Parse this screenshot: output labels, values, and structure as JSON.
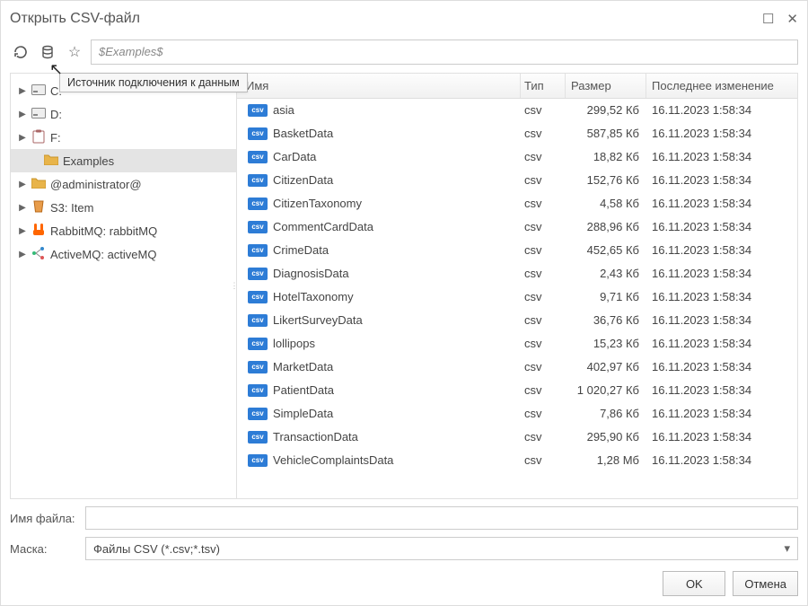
{
  "window": {
    "title": "Открыть CSV-файл"
  },
  "toolbar": {
    "path_placeholder": "$Examples$",
    "tooltip": "Источник подключения к данным"
  },
  "tree": {
    "items": [
      {
        "label": "C:",
        "icon": "drive",
        "expandable": true,
        "selected": false
      },
      {
        "label": "D:",
        "icon": "drive",
        "expandable": true,
        "selected": false
      },
      {
        "label": "F:",
        "icon": "clipboard",
        "expandable": true,
        "selected": false
      },
      {
        "label": "Examples",
        "icon": "folder",
        "expandable": false,
        "selected": true
      },
      {
        "label": "@administrator@",
        "icon": "folder-user",
        "expandable": true,
        "selected": false
      },
      {
        "label": "S3: Item",
        "icon": "bucket",
        "expandable": true,
        "selected": false
      },
      {
        "label": "RabbitMQ: rabbitMQ",
        "icon": "rabbit",
        "expandable": true,
        "selected": false
      },
      {
        "label": "ActiveMQ: activeMQ",
        "icon": "nodes",
        "expandable": true,
        "selected": false
      }
    ]
  },
  "columns": {
    "name": "Имя",
    "type": "Тип",
    "size": "Размер",
    "modified": "Последнее изменение"
  },
  "files": [
    {
      "name": "asia",
      "type": "csv",
      "size": "299,52 Кб",
      "modified": "16.11.2023 1:58:34"
    },
    {
      "name": "BasketData",
      "type": "csv",
      "size": "587,85 Кб",
      "modified": "16.11.2023 1:58:34"
    },
    {
      "name": "CarData",
      "type": "csv",
      "size": "18,82 Кб",
      "modified": "16.11.2023 1:58:34"
    },
    {
      "name": "CitizenData",
      "type": "csv",
      "size": "152,76 Кб",
      "modified": "16.11.2023 1:58:34"
    },
    {
      "name": "CitizenTaxonomy",
      "type": "csv",
      "size": "4,58 Кб",
      "modified": "16.11.2023 1:58:34"
    },
    {
      "name": "CommentCardData",
      "type": "csv",
      "size": "288,96 Кб",
      "modified": "16.11.2023 1:58:34"
    },
    {
      "name": "CrimeData",
      "type": "csv",
      "size": "452,65 Кб",
      "modified": "16.11.2023 1:58:34"
    },
    {
      "name": "DiagnosisData",
      "type": "csv",
      "size": "2,43 Кб",
      "modified": "16.11.2023 1:58:34"
    },
    {
      "name": "HotelTaxonomy",
      "type": "csv",
      "size": "9,71 Кб",
      "modified": "16.11.2023 1:58:34"
    },
    {
      "name": "LikertSurveyData",
      "type": "csv",
      "size": "36,76 Кб",
      "modified": "16.11.2023 1:58:34"
    },
    {
      "name": "lollipops",
      "type": "csv",
      "size": "15,23 Кб",
      "modified": "16.11.2023 1:58:34"
    },
    {
      "name": "MarketData",
      "type": "csv",
      "size": "402,97 Кб",
      "modified": "16.11.2023 1:58:34"
    },
    {
      "name": "PatientData",
      "type": "csv",
      "size": "1 020,27 Кб",
      "modified": "16.11.2023 1:58:34"
    },
    {
      "name": "SimpleData",
      "type": "csv",
      "size": "7,86 Кб",
      "modified": "16.11.2023 1:58:34"
    },
    {
      "name": "TransactionData",
      "type": "csv",
      "size": "295,90 Кб",
      "modified": "16.11.2023 1:58:34"
    },
    {
      "name": "VehicleComplaintsData",
      "type": "csv",
      "size": "1,28 Мб",
      "modified": "16.11.2023 1:58:34"
    }
  ],
  "bottom": {
    "filename_label": "Имя файла:",
    "filename_value": "",
    "mask_label": "Маска:",
    "mask_value": "Файлы CSV (*.csv;*.tsv)"
  },
  "buttons": {
    "ok": "OK",
    "cancel": "Отмена"
  },
  "icons": {
    "drive": "▤",
    "clipboard": "📋",
    "folder": "📁",
    "folder-user": "📁",
    "bucket": "🗄",
    "rabbit": "🐇",
    "nodes": "⋮⋮"
  }
}
